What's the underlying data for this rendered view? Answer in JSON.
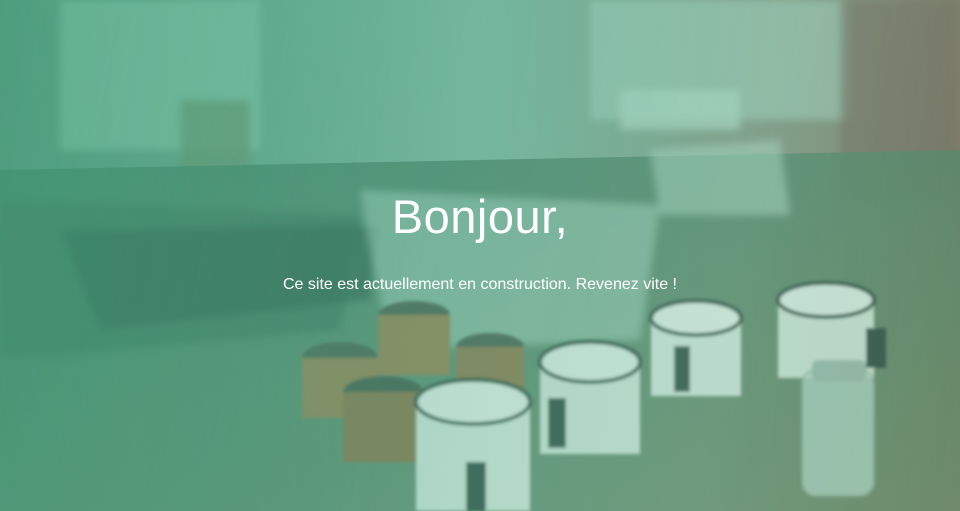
{
  "hero": {
    "title": "Bonjour,",
    "message": "Ce site est actuellement en construction. Revenez vite !"
  },
  "theme": {
    "overlay_color": "#4fae8a",
    "text_color": "#ffffff"
  }
}
